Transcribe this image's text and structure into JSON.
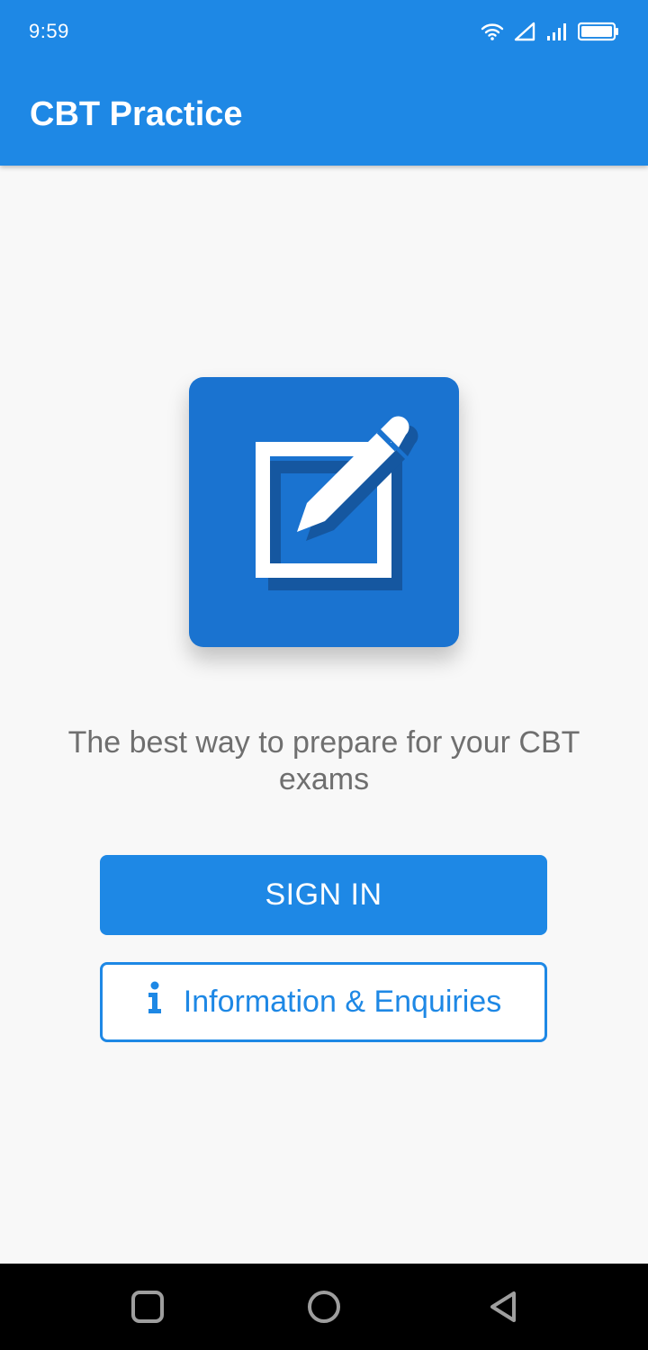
{
  "status_bar": {
    "time": "9:59",
    "icons": [
      "wifi-icon",
      "signal-outline-icon",
      "signal-bars-icon",
      "battery-icon"
    ]
  },
  "app_bar": {
    "title": "CBT Practice",
    "color": "#1e88e5"
  },
  "hero": {
    "icon": "edit-square-icon",
    "tile_color": "#1a73d0",
    "tagline": "The best way to prepare for your CBT exams"
  },
  "actions": {
    "sign_in_label": "SIGN IN",
    "info_label": "Information & Enquiries",
    "info_icon": "info-icon"
  },
  "nav_bar": {
    "icons": [
      "recents-square-icon",
      "home-circle-icon",
      "back-triangle-icon"
    ]
  }
}
